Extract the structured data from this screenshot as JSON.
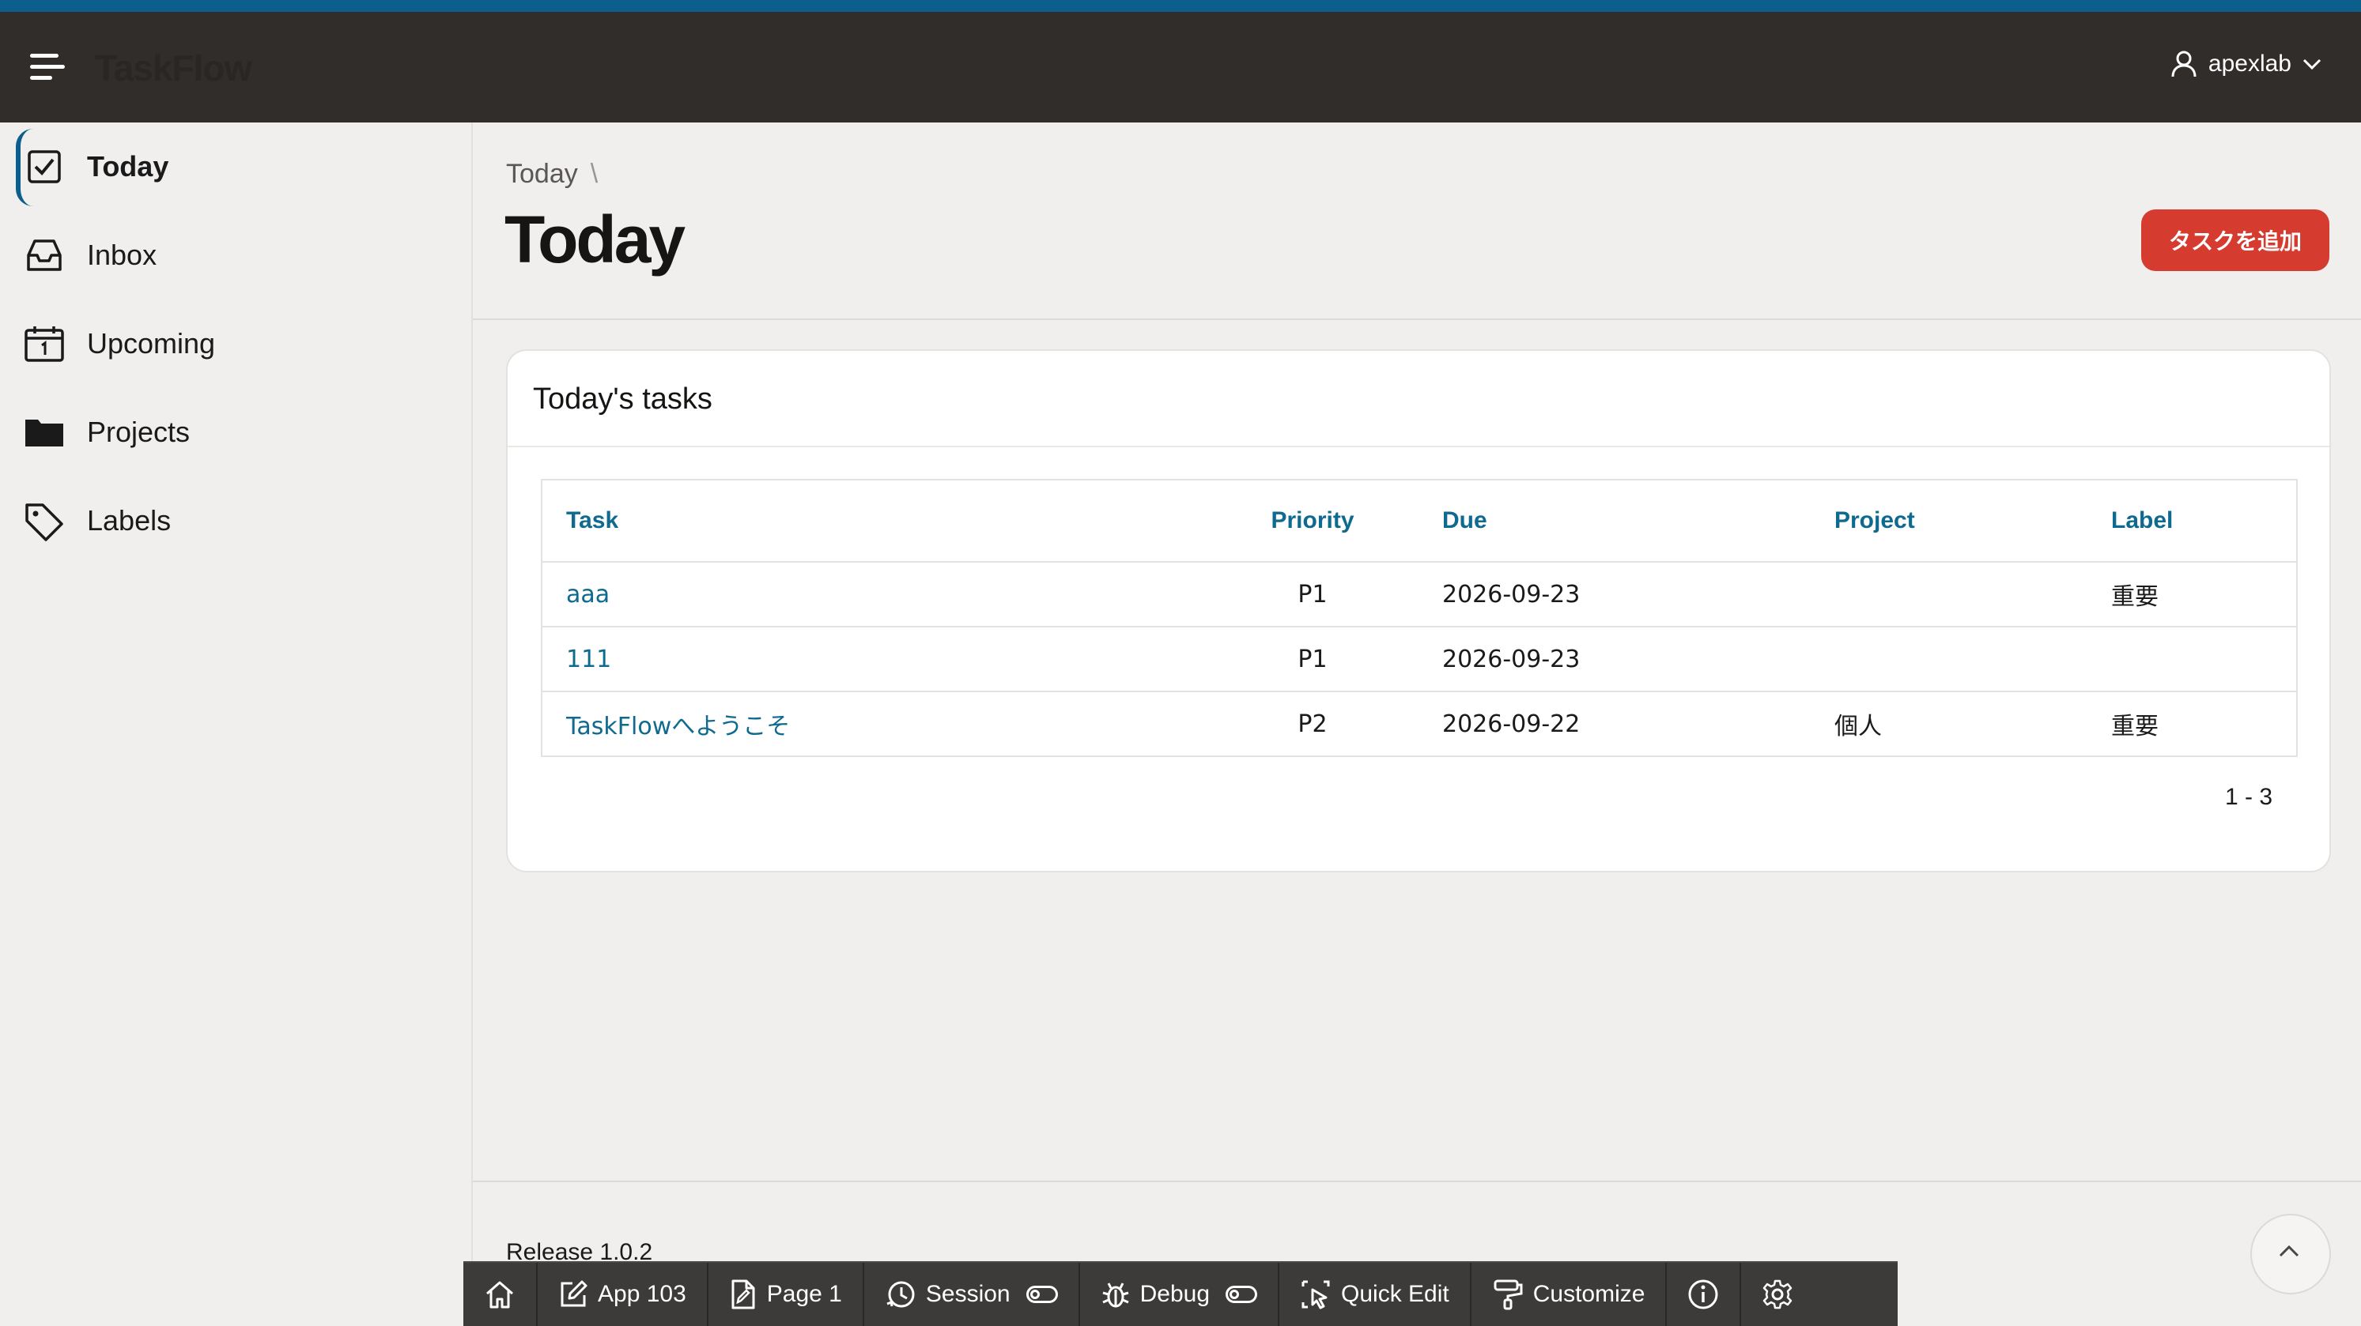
{
  "header": {
    "app_title": "TaskFlow",
    "user_name": "apexlab"
  },
  "sidebar": {
    "items": [
      {
        "label": "Today",
        "icon": "checkbox-icon",
        "active": true
      },
      {
        "label": "Inbox",
        "icon": "inbox-icon"
      },
      {
        "label": "Upcoming",
        "icon": "calendar-icon"
      },
      {
        "label": "Projects",
        "icon": "folder-icon"
      },
      {
        "label": "Labels",
        "icon": "tag-icon"
      }
    ]
  },
  "page": {
    "breadcrumb": "Today",
    "breadcrumb_separator": "\\",
    "title": "Today",
    "add_button": "タスクを追加"
  },
  "report": {
    "title": "Today's tasks",
    "columns": [
      "Task",
      "Priority",
      "Due",
      "Project",
      "Label"
    ],
    "rows": [
      {
        "task": "aaa",
        "priority": "P1",
        "due": "2026-09-23",
        "project": "",
        "label": "重要"
      },
      {
        "task": "111",
        "priority": "P1",
        "due": "2026-09-23",
        "project": "",
        "label": ""
      },
      {
        "task": "TaskFlowへようこそ",
        "priority": "P2",
        "due": "2026-09-22",
        "project": "個人",
        "label": "重要"
      }
    ],
    "pagination": "1 - 3"
  },
  "footer": {
    "release": "Release 1.0.2"
  },
  "devbar": {
    "app": "App 103",
    "page": "Page 1",
    "session": "Session",
    "debug": "Debug",
    "quick_edit": "Quick Edit",
    "customize": "Customize"
  },
  "colors": {
    "brand_strip": "#0c5f8c",
    "header_bg": "#312d2a",
    "accent_button": "#d63b2f",
    "link": "#0e6a8f"
  }
}
